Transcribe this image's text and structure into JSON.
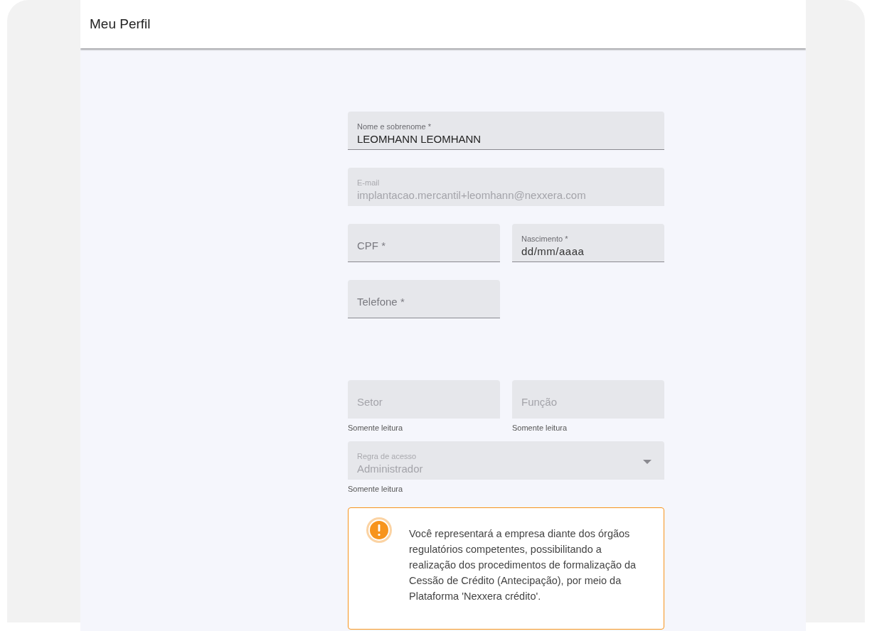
{
  "header": {
    "title": "Meu Perfil"
  },
  "rows": [
    {
      "fields": [
        {
          "kind": "text",
          "label": "Nome e sobrenome *",
          "value": "LEOMHANN LEOMHANN",
          "disabled": false
        }
      ]
    },
    {
      "fields": [
        {
          "kind": "text",
          "label": "E-mail",
          "value": "implantacao.mercantil+leomhann@nexxera.com",
          "disabled": true
        }
      ]
    },
    {
      "fields": [
        {
          "kind": "text",
          "label": "CPF *",
          "disabled": false
        },
        {
          "kind": "date",
          "label": "Nascimento *",
          "placeholder": "dd/mm/aaaa",
          "disabled": false
        }
      ]
    },
    {
      "fields": [
        {
          "kind": "text",
          "label": "Telefone *",
          "disabled": false
        }
      ]
    },
    {
      "fields": [
        {
          "kind": "text",
          "label": "Setor",
          "disabled": true,
          "helper": "Somente leitura"
        },
        {
          "kind": "text",
          "label": "Função",
          "disabled": true,
          "helper": "Somente leitura"
        }
      ]
    },
    {
      "fields": [
        {
          "kind": "select",
          "label": "Regra de acesso",
          "value": "Administrador",
          "disabled": true,
          "helper": "Somente leitura"
        }
      ]
    }
  ],
  "alert": {
    "kind": "warning",
    "text": "Você representará a empresa diante dos órgãos regulatórios competentes, possibilitando a realização dos procedimentos de formalização da Cessão de Crédito (Antecipação), por meio da Plataforma 'Nexxera crédito'."
  }
}
